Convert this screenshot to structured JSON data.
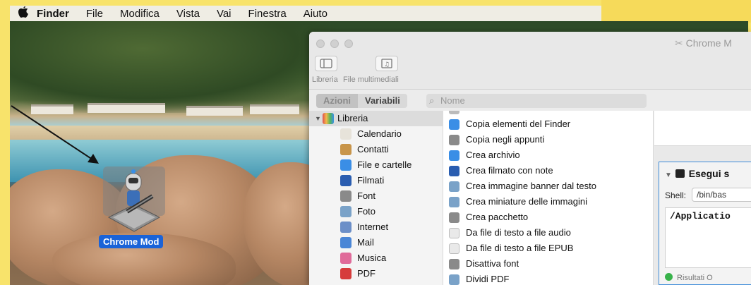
{
  "menubar": {
    "apple_icon": "apple-icon",
    "items": [
      "Finder",
      "File",
      "Modifica",
      "Vista",
      "Vai",
      "Finestra",
      "Aiuto"
    ]
  },
  "desktop": {
    "icon_label": "Chrome Mod",
    "icon_name": "automator-robot-icon"
  },
  "window": {
    "title": "Chrome M",
    "toolbar": {
      "library_label": "Libreria",
      "media_label": "File multimediali"
    },
    "tabs": [
      "Azioni",
      "Variabili"
    ],
    "search_placeholder": "Nome",
    "library": {
      "root": "Libreria",
      "items": [
        {
          "label": "Calendario",
          "icon": "calendar-icon",
          "color": "#e7e3da"
        },
        {
          "label": "Contatti",
          "icon": "contacts-icon",
          "color": "#c8954a"
        },
        {
          "label": "File e cartelle",
          "icon": "finder-icon",
          "color": "#3a8ee6"
        },
        {
          "label": "Filmati",
          "icon": "quicktime-icon",
          "color": "#2a5db0"
        },
        {
          "label": "Font",
          "icon": "font-book-icon",
          "color": "#8a8a8a"
        },
        {
          "label": "Foto",
          "icon": "photos-icon",
          "color": "#7aa2c8"
        },
        {
          "label": "Internet",
          "icon": "globe-icon",
          "color": "#6c8fc8"
        },
        {
          "label": "Mail",
          "icon": "mail-icon",
          "color": "#4a86d6"
        },
        {
          "label": "Musica",
          "icon": "music-icon",
          "color": "#e06b9a"
        },
        {
          "label": "PDF",
          "icon": "pdf-icon",
          "color": "#d63c3c"
        }
      ]
    },
    "actions": [
      {
        "label": "Copia elementi del Finder",
        "icon": "finder-icon",
        "color": "#3a8ee6"
      },
      {
        "label": "Copia negli appunti",
        "icon": "tools-icon",
        "color": "#8a8a8a"
      },
      {
        "label": "Crea archivio",
        "icon": "finder-icon",
        "color": "#3a8ee6"
      },
      {
        "label": "Crea filmato con note",
        "icon": "quicktime-icon",
        "color": "#2a5db0"
      },
      {
        "label": "Crea immagine banner dal testo",
        "icon": "image-icon",
        "color": "#7aa2c8"
      },
      {
        "label": "Crea miniature delle immagini",
        "icon": "image-icon",
        "color": "#7aa2c8"
      },
      {
        "label": "Crea pacchetto",
        "icon": "tools-icon",
        "color": "#8a8a8a"
      },
      {
        "label": "Da file di testo a file audio",
        "icon": "text-file-icon",
        "color": "#e9e9e9"
      },
      {
        "label": "Da file di testo a file EPUB",
        "icon": "text-file-icon",
        "color": "#e9e9e9"
      },
      {
        "label": "Disattiva font",
        "icon": "font-book-icon",
        "color": "#8a8a8a"
      },
      {
        "label": "Dividi PDF",
        "icon": "image-icon",
        "color": "#7aa2c8"
      }
    ],
    "workflow": {
      "action_title": "Esegui s",
      "shell_label": "Shell:",
      "shell_value": "/bin/bas",
      "script": "/Applicatio",
      "footer": "Risultati   O"
    }
  }
}
